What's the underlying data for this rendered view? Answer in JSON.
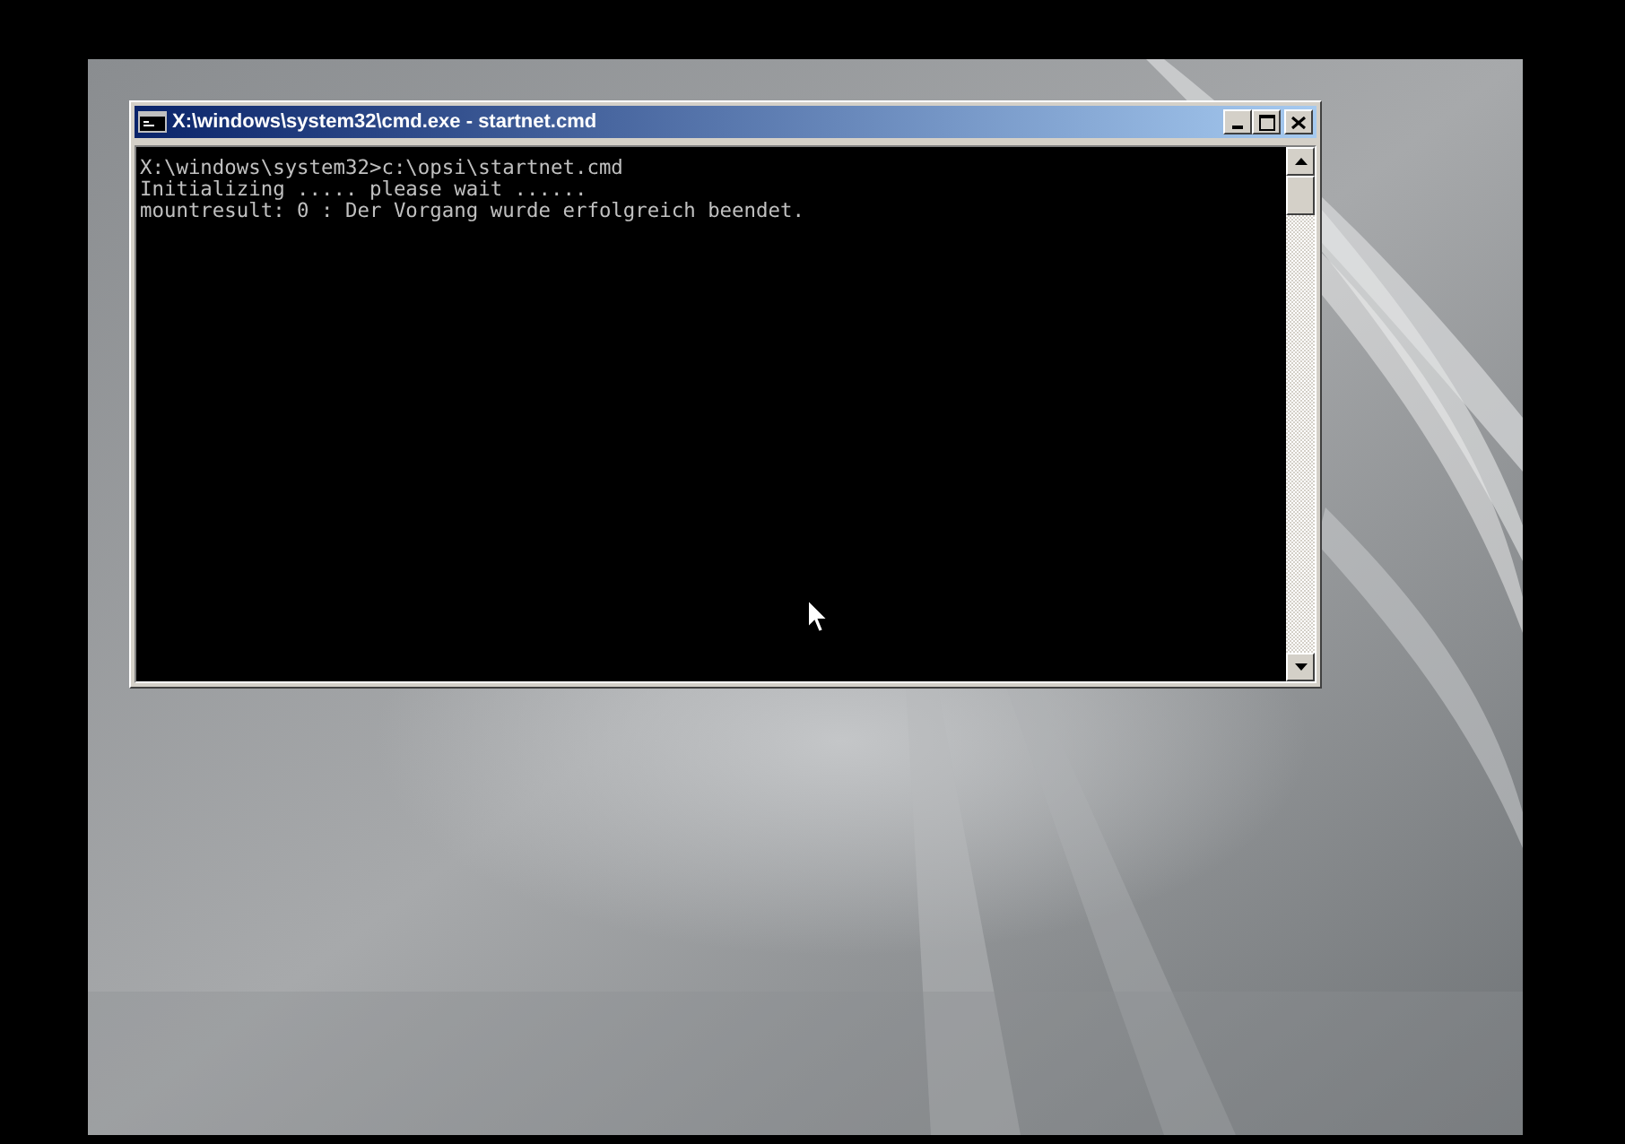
{
  "window": {
    "title": "X:\\windows\\system32\\cmd.exe - startnet.cmd"
  },
  "console": {
    "lines": [
      "X:\\windows\\system32>c:\\opsi\\startnet.cmd",
      "Initializing ..... please wait ......",
      "mountresult: 0 : Der Vorgang wurde erfolgreich beendet."
    ]
  }
}
